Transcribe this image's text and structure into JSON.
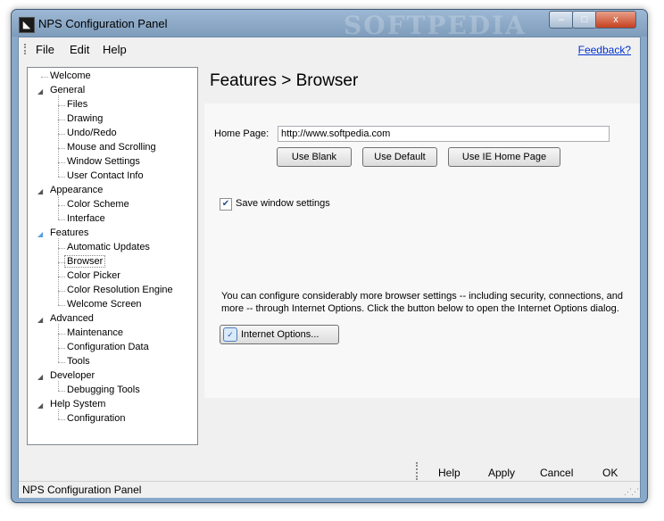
{
  "window": {
    "title": "NPS Configuration Panel",
    "watermark": "SOFTPEDIA",
    "buttons": {
      "minimize": "–",
      "maximize": "□",
      "close": "x"
    }
  },
  "menu": {
    "items": [
      "File",
      "Edit",
      "Help"
    ],
    "feedback": "Feedback?"
  },
  "tree": {
    "items": [
      {
        "label": "Welcome",
        "level": 0,
        "expander": ""
      },
      {
        "label": "General",
        "level": 0,
        "expander": "◢"
      },
      {
        "label": "Files",
        "level": 1
      },
      {
        "label": "Drawing",
        "level": 1
      },
      {
        "label": "Undo/Redo",
        "level": 1
      },
      {
        "label": "Mouse and Scrolling",
        "level": 1
      },
      {
        "label": "Window Settings",
        "level": 1
      },
      {
        "label": "User Contact Info",
        "level": 1
      },
      {
        "label": "Appearance",
        "level": 0,
        "expander": "◢"
      },
      {
        "label": "Color Scheme",
        "level": 1
      },
      {
        "label": "Interface",
        "level": 1
      },
      {
        "label": "Features",
        "level": 0,
        "expander": "◢"
      },
      {
        "label": "Automatic Updates",
        "level": 1
      },
      {
        "label": "Browser",
        "level": 1,
        "selected": true
      },
      {
        "label": "Color Picker",
        "level": 1
      },
      {
        "label": "Color Resolution Engine",
        "level": 1
      },
      {
        "label": "Welcome Screen",
        "level": 1
      },
      {
        "label": "Advanced",
        "level": 0,
        "expander": "◢"
      },
      {
        "label": "Maintenance",
        "level": 1
      },
      {
        "label": "Configuration Data",
        "level": 1
      },
      {
        "label": "Tools",
        "level": 1
      },
      {
        "label": "Developer",
        "level": 0,
        "expander": "◢"
      },
      {
        "label": "Debugging Tools",
        "level": 1
      },
      {
        "label": "Help System",
        "level": 0,
        "expander": "◢"
      },
      {
        "label": "Configuration",
        "level": 1
      }
    ]
  },
  "content": {
    "breadcrumb": "Features > Browser",
    "home_page_label": "Home Page:",
    "home_page_value": "http://www.softpedia.com",
    "use_blank": "Use Blank",
    "use_default": "Use Default",
    "use_ie": "Use IE Home Page",
    "save_window_settings": "Save window settings",
    "save_checked": true,
    "info": "You can configure considerably more browser settings -- including security, connections, and more -- through Internet Options. Click the button below to open the Internet Options dialog.",
    "internet_options": "Internet Options..."
  },
  "footer": {
    "help": "Help",
    "apply": "Apply",
    "cancel": "Cancel",
    "ok": "OK"
  },
  "status": {
    "text": "NPS Configuration Panel"
  }
}
